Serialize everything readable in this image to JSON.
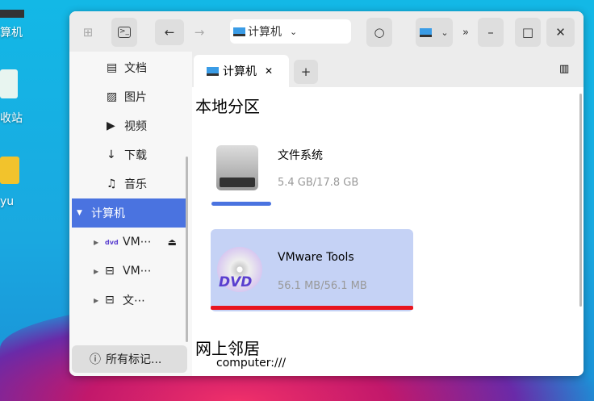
{
  "desktop": {
    "icons": [
      "算机",
      "收站",
      "yu"
    ]
  },
  "toolbar": {
    "address": "计算机",
    "search_icon": "search-icon"
  },
  "sidebar": {
    "items": [
      {
        "label": "文档"
      },
      {
        "label": "图片"
      },
      {
        "label": "视频"
      },
      {
        "label": "下载"
      },
      {
        "label": "音乐"
      }
    ],
    "computer": "计算机",
    "devices": [
      {
        "label": "VM⋯"
      },
      {
        "label": "VM⋯"
      },
      {
        "label": "文⋯"
      }
    ],
    "tags": "所有标记..."
  },
  "tab": {
    "label": "计算机"
  },
  "main": {
    "local_heading": "本地分区",
    "drives": [
      {
        "name": "文件系统",
        "usage": "5.4 GB/17.8 GB",
        "fill": 0.3
      },
      {
        "name": "VMware Tools",
        "usage": "56.1 MB/56.1 MB",
        "fill": 1.0
      }
    ],
    "network_heading": "网上邻居",
    "network_item": "computer:///"
  },
  "colors": {
    "accent": "#4a73e0",
    "selected": "#c5d2f5",
    "full": "#e8141e",
    "bar": "#4a73e0"
  }
}
